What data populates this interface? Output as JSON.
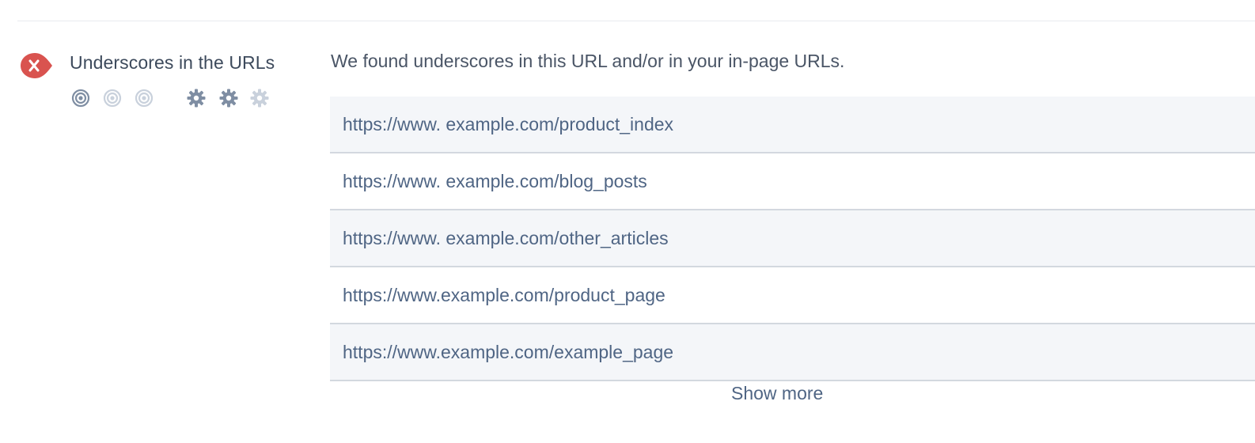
{
  "check": {
    "status": "error",
    "status_color": "#d9534f",
    "status_icon": "error-x-icon",
    "title": "Underscores in the URLs",
    "description": "We found underscores in this URL and/or in your in-page URLs.",
    "importance": {
      "icon": "target-icon",
      "level": 1,
      "max": 3
    },
    "difficulty": {
      "icon": "gear-icon",
      "level": 2,
      "max": 3
    },
    "urls": [
      "https://www. example.com/product_index",
      "https://www. example.com/blog_posts",
      "https://www. example.com/other_articles",
      "https://www.example.com/product_page",
      "https://www.example.com/example_page"
    ],
    "show_more_label": "Show more"
  },
  "colors": {
    "indicator_active": "#7f8ea3",
    "indicator_inactive": "#c9d1dc",
    "link": "#4f6584",
    "row_shaded": "#f4f6f9",
    "row_border": "#d3d8df"
  }
}
